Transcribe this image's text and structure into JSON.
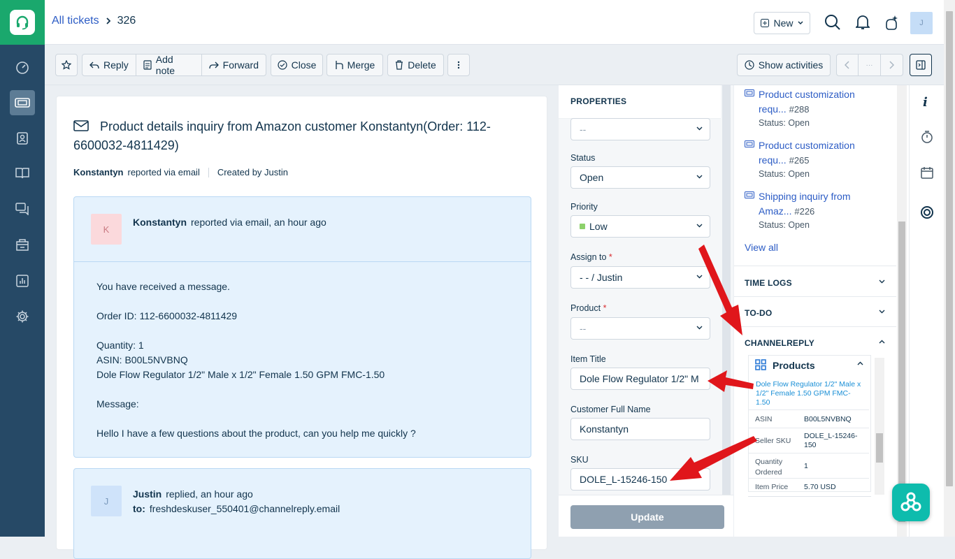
{
  "header": {
    "breadcrumb_link": "All tickets",
    "ticket_number": "326",
    "new_label": "New",
    "avatar_initial": "J"
  },
  "toolbar": {
    "reply": "Reply",
    "add_note": "Add note",
    "forward": "Forward",
    "close": "Close",
    "merge": "Merge",
    "delete": "Delete",
    "show_activities": "Show activities",
    "pager_mid": "···"
  },
  "ticket": {
    "subject": "Product details inquiry from Amazon customer Konstantyn(Order: 112-6600032-4811429)",
    "requester": "Konstantyn",
    "reported_via": "reported via email",
    "created_by": "Created by Justin"
  },
  "message1": {
    "avatar": "K",
    "author": "Konstantyn",
    "meta": "reported via email, an hour ago",
    "lines": [
      "You have received a message.",
      "Order ID: 112-6600032-4811429",
      "Quantity: 1",
      "ASIN: B00L5NVBNQ",
      "Dole Flow Regulator 1/2\" Male x 1/2\" Female 1.50 GPM FMC-1.50",
      "Message:",
      "Hello I have a few questions about the product, can you help me quickly ?"
    ]
  },
  "message2": {
    "avatar": "J",
    "author": "Justin",
    "meta": "replied, an hour ago",
    "to_label": "to:",
    "to_value": "freshdeskuser_550401@channelreply.email"
  },
  "properties": {
    "title": "PROPERTIES",
    "type_value": "--",
    "status_label": "Status",
    "status_value": "Open",
    "priority_label": "Priority",
    "priority_value": "Low",
    "priority_color": "#8dd16b",
    "assign_label": "Assign to",
    "assign_value": "- - / Justin",
    "product_label": "Product",
    "product_value": "--",
    "item_title_label": "Item Title",
    "item_title_value": "Dole Flow Regulator 1/2\" M",
    "customer_label": "Customer Full Name",
    "customer_value": "Konstantyn",
    "sku_label": "SKU",
    "sku_value": "DOLE_L-15246-150",
    "required_mark": "*",
    "update": "Update"
  },
  "related": [
    {
      "title1": "Product customization",
      "title2": "requ...",
      "num": "#288",
      "status": "Status: Open"
    },
    {
      "title1": "Product customization",
      "title2": "requ...",
      "num": "#265",
      "status": "Status: Open"
    },
    {
      "title1": "Shipping inquiry from",
      "title2": "Amaz...",
      "num": "#226",
      "status": "Status: Open"
    }
  ],
  "view_all": "View all",
  "sections": {
    "time_logs": "TIME LOGS",
    "todo": "TO-DO",
    "channelreply": "CHANNELREPLY"
  },
  "channelreply": {
    "products_title": "Products",
    "product_link": "Dole Flow Regulator 1/2\" Male x 1/2\" Female 1.50 GPM FMC-1.50",
    "asin_label": "ASIN",
    "asin_value": "B00L5NVBNQ",
    "seller_sku_label": "Seller SKU",
    "seller_sku_value": "DOLE_L-15246-150",
    "qty_label": "Quantity Ordered",
    "qty_value": "1",
    "price_label": "Item Price",
    "price_value": "5.70 USD"
  },
  "colors": {
    "sidebar": "#264966",
    "brand_green": "#1aa86d",
    "link": "#2c5cc5",
    "annotation_red": "#e0161b"
  }
}
